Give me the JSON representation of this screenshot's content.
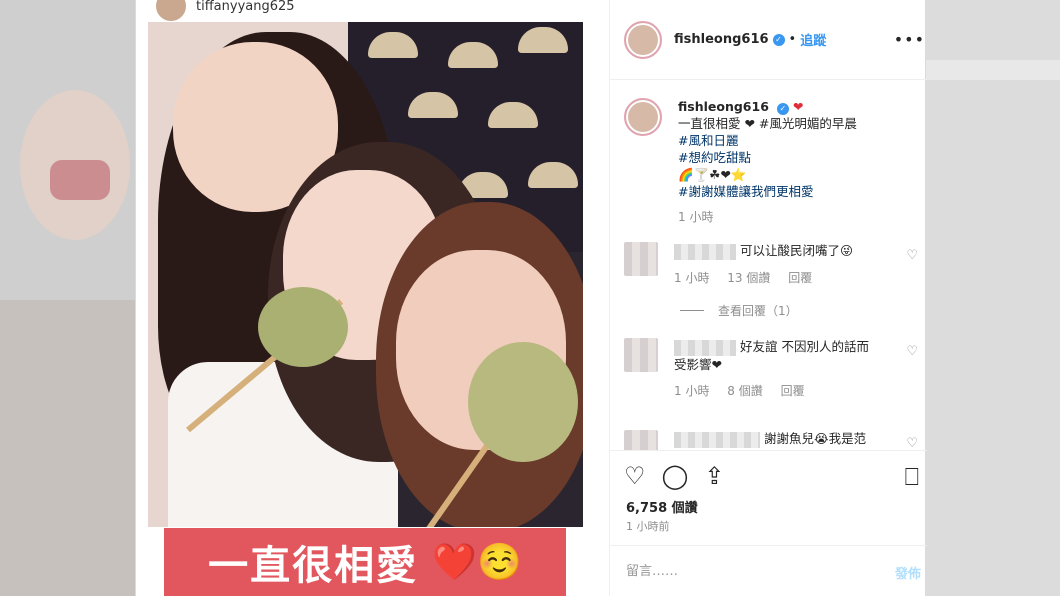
{
  "original_post": {
    "username": "tiffanyyang625"
  },
  "photo": {
    "caption_text": "一直很相愛",
    "caption_emojis": "❤️☺️"
  },
  "header": {
    "username": "fishleong616",
    "verified_icon": "✓",
    "separator": "•",
    "follow_label": "追蹤",
    "more_label": "•••"
  },
  "post": {
    "username": "fishleong616",
    "title_emoji": "❤",
    "lines": [
      "一直很相愛 ❤ #風光明媚的早晨",
      "#風和日麗",
      "#想約吃甜點",
      "🌈🍸☘❤⭐",
      "#謝謝媒體讓我們更相愛"
    ],
    "time": "1 小時"
  },
  "comments": [
    {
      "text": "可以让酸民闭嘴了😜",
      "time": "1 小時",
      "likes": "13 個讚",
      "reply": "回覆",
      "view_replies": "查看回覆（1）"
    },
    {
      "text": "好友誼 不因別人的話而受影響❤",
      "time": "1 小時",
      "likes": "8 個讚",
      "reply": "回覆"
    },
    {
      "text": "謝謝魚兒😭我是范"
    }
  ],
  "actions": {
    "like_icon": "♡",
    "comment_icon": "◯",
    "share_icon": "⇪",
    "save_icon": "⎕"
  },
  "stats": {
    "likes": "6,758 個讚",
    "posted": "1 小時前"
  },
  "comment_box": {
    "placeholder": "留言……",
    "publish": "發佈"
  }
}
